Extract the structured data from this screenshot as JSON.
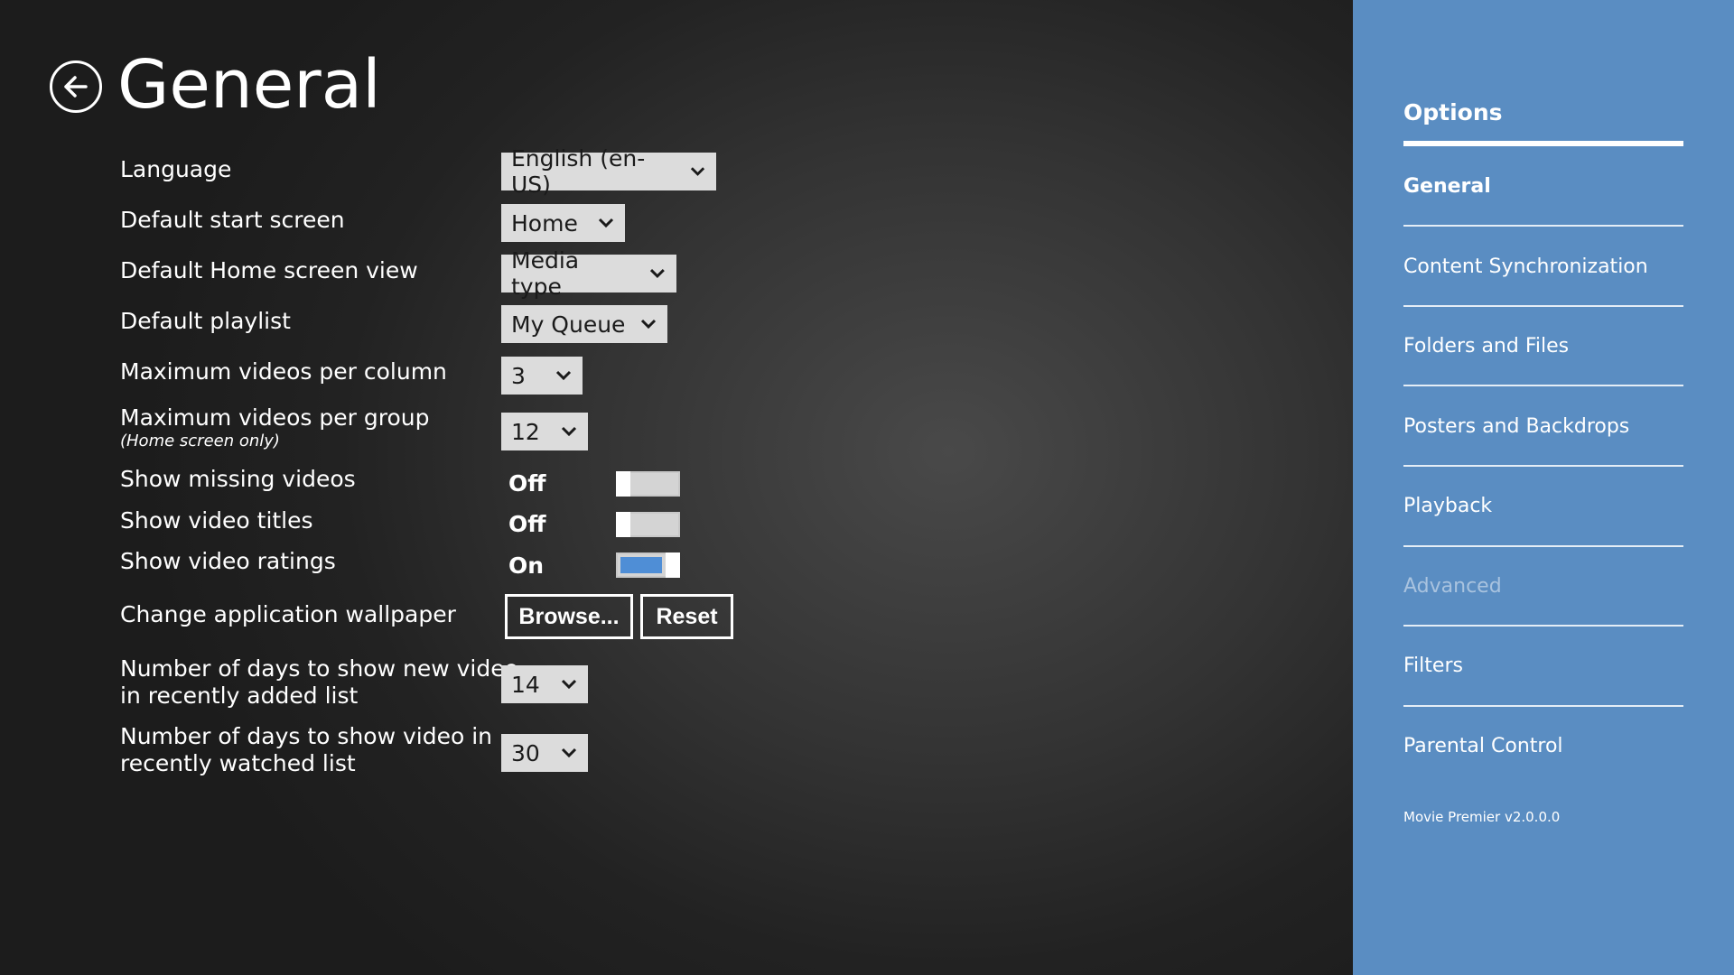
{
  "header": {
    "title": "General"
  },
  "settings": {
    "language": {
      "label": "Language",
      "value": "English (en-US)"
    },
    "start_screen": {
      "label": "Default start screen",
      "value": "Home"
    },
    "home_view": {
      "label": "Default Home screen view",
      "value": "Media type"
    },
    "playlist": {
      "label": "Default playlist",
      "value": "My Queue"
    },
    "max_per_column": {
      "label": "Maximum videos per column",
      "value": "3"
    },
    "max_per_group": {
      "label": "Maximum videos per group",
      "sublabel": "(Home screen only)",
      "value": "12"
    },
    "missing_videos": {
      "label": "Show missing videos",
      "state": "Off"
    },
    "video_titles": {
      "label": "Show video titles",
      "state": "Off"
    },
    "video_ratings": {
      "label": "Show video ratings",
      "state": "On"
    },
    "wallpaper": {
      "label": "Change application wallpaper",
      "browse": "Browse...",
      "reset": "Reset"
    },
    "new_days": {
      "label_line1": "Number of days to show new video",
      "label_line2": "in recently added list",
      "value": "14"
    },
    "watched_days": {
      "label_line1": "Number of days to show video in",
      "label_line2": "recently watched list",
      "value": "30"
    }
  },
  "sidebar": {
    "title": "Options",
    "items": [
      {
        "label": "General",
        "state": "active"
      },
      {
        "label": "Content Synchronization",
        "state": "normal"
      },
      {
        "label": "Folders and Files",
        "state": "normal"
      },
      {
        "label": "Posters and Backdrops",
        "state": "normal"
      },
      {
        "label": "Playback",
        "state": "normal"
      },
      {
        "label": "Advanced",
        "state": "disabled"
      },
      {
        "label": "Filters",
        "state": "normal"
      },
      {
        "label": "Parental Control",
        "state": "normal"
      }
    ],
    "version": "Movie Premier v2.0.0.0"
  },
  "colors": {
    "sidebar_bg": "#5a8dc2",
    "toggle_on": "#4f8ed6",
    "dropdown_bg": "#dcdcdc"
  },
  "icons": {
    "back": "back-arrow-icon",
    "dropdown": "chevron-down-icon"
  }
}
